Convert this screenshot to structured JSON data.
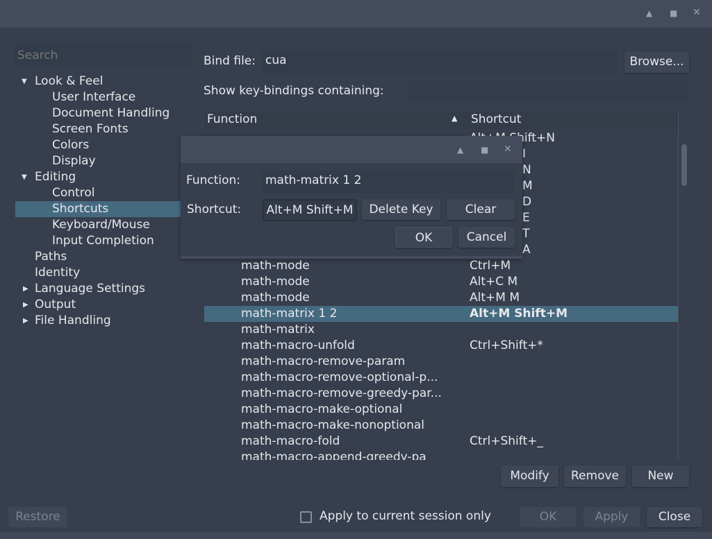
{
  "window": {
    "controls": [
      "minimize-icon",
      "maximize-icon",
      "close-icon"
    ]
  },
  "search": {
    "placeholder": "Search"
  },
  "tree": [
    {
      "label": "Look & Feel",
      "level": 0,
      "expanded": true
    },
    {
      "label": "User Interface",
      "level": 1
    },
    {
      "label": "Document Handling",
      "level": 1
    },
    {
      "label": "Screen Fonts",
      "level": 1
    },
    {
      "label": "Colors",
      "level": 1
    },
    {
      "label": "Display",
      "level": 1
    },
    {
      "label": "Editing",
      "level": 0,
      "expanded": true
    },
    {
      "label": "Control",
      "level": 1
    },
    {
      "label": "Shortcuts",
      "level": 1,
      "selected": true
    },
    {
      "label": "Keyboard/Mouse",
      "level": 1
    },
    {
      "label": "Input Completion",
      "level": 1
    },
    {
      "label": "Paths",
      "level": 0
    },
    {
      "label": "Identity",
      "level": 0
    },
    {
      "label": "Language Settings",
      "level": 0,
      "collapsed": true
    },
    {
      "label": "Output",
      "level": 0,
      "collapsed": true
    },
    {
      "label": "File Handling",
      "level": 0,
      "collapsed": true
    }
  ],
  "bindfile": {
    "label": "Bind file:",
    "value": "cua",
    "browse": "Browse..."
  },
  "filter": {
    "label": "Show key-bindings containing:",
    "value": ""
  },
  "table": {
    "headers": {
      "function": "Function",
      "shortcut": "Shortcut"
    },
    "hidden_top_shortcut": "Alt+M Shift+N",
    "hidden_fragments": [
      "I",
      "N",
      "M",
      "D",
      "E",
      "T",
      "A"
    ],
    "rows": [
      {
        "function": "math-mode",
        "shortcut": "Ctrl+M"
      },
      {
        "function": "math-mode",
        "shortcut": "Alt+C M"
      },
      {
        "function": "math-mode",
        "shortcut": "Alt+M M"
      },
      {
        "function": "math-matrix 1 2",
        "shortcut": "Alt+M Shift+M",
        "selected": true
      },
      {
        "function": "math-matrix",
        "shortcut": ""
      },
      {
        "function": "math-macro-unfold",
        "shortcut": "Ctrl+Shift+*"
      },
      {
        "function": "math-macro-remove-param",
        "shortcut": ""
      },
      {
        "function": "math-macro-remove-optional-p...",
        "shortcut": ""
      },
      {
        "function": "math-macro-remove-greedy-par...",
        "shortcut": ""
      },
      {
        "function": "math-macro-make-optional",
        "shortcut": ""
      },
      {
        "function": "math-macro-make-nonoptional",
        "shortcut": ""
      },
      {
        "function": "math-macro-fold",
        "shortcut": "Ctrl+Shift+_"
      },
      {
        "function": "math-macro-append-greedy-pa",
        "shortcut": ""
      }
    ]
  },
  "actions": {
    "modify": "Modify",
    "remove": "Remove",
    "new": "New"
  },
  "footer": {
    "restore": "Restore",
    "session_only": "Apply to current session only",
    "session_checked": false,
    "ok": "OK",
    "apply": "Apply",
    "close": "Close"
  },
  "dialog": {
    "function_label": "Function:",
    "function_value": "math-matrix 1 2",
    "shortcut_label": "Shortcut:",
    "shortcut_value": "Alt+M Shift+M",
    "delete_key": "Delete Key",
    "clear": "Clear",
    "ok": "OK",
    "cancel": "Cancel"
  },
  "colors": {
    "background": "#373e4d",
    "titlebar": "#434b5c",
    "selection": "#456a80"
  }
}
